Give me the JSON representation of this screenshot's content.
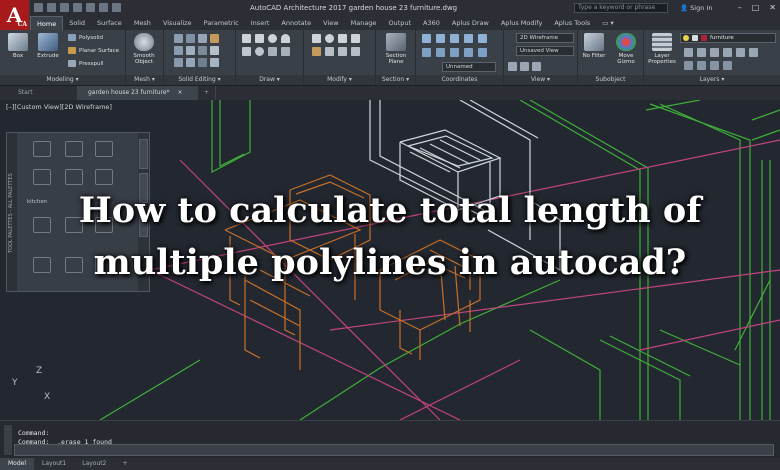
{
  "titlebar": {
    "app_letter": "A",
    "app_suffix": "CA",
    "title": "AutoCAD Architecture 2017   garden house 23 furniture.dwg",
    "search_placeholder": "Type a keyword or phrase",
    "sign_in": "Sign In",
    "minimize": "–",
    "maximize": "□",
    "close": "✕"
  },
  "ribbon_tabs": [
    "Home",
    "Solid",
    "Surface",
    "Mesh",
    "Visualize",
    "Parametric",
    "Insert",
    "Annotate",
    "View",
    "Manage",
    "Output",
    "A360",
    "Aplus Draw",
    "Aplus Modify",
    "Aplus Tools",
    "▭ ▾"
  ],
  "ribbon": {
    "modeling": {
      "label": "Modeling ▾",
      "box": "Box",
      "extrude": "Extrude",
      "polysolid": "Polysolid",
      "planar_surface": "Planar Surface",
      "presspull": "Presspull"
    },
    "mesh": {
      "label": "Mesh ▾",
      "smooth_object": "Smooth Object"
    },
    "solid_editing": {
      "label": "Solid Editing ▾"
    },
    "draw": {
      "label": "Draw ▾"
    },
    "modify": {
      "label": "Modify ▾"
    },
    "section": {
      "label": "Section ▾",
      "section_plane": "Section Plane"
    },
    "coordinates": {
      "label": "Coordinates",
      "unnamed": "Unnamed"
    },
    "view": {
      "label": "View ▾",
      "visual_style": "2D Wireframe",
      "saved_view": "Unsaved View"
    },
    "subobject": {
      "label": "Subobject",
      "no_filter": "No Filter",
      "move_gizmo": "Move Gizmo"
    },
    "layers": {
      "label": "Layers ▾",
      "layer_properties": "Layer Properties",
      "current_layer": "furniture"
    }
  },
  "file_tabs": {
    "start": "Start",
    "drawing": "garden house 23 furniture*",
    "close": "×",
    "new_tab": "+"
  },
  "viewport": {
    "label": "[–][Custom View][2D Wireframe]",
    "palette_title": "TOOL PALETTES - ALL PALETTES",
    "palette_category": "kitchen",
    "ucs_x": "X",
    "ucs_y": "Y",
    "ucs_z": "Z"
  },
  "headline": {
    "line1": "How to calculate total length of",
    "line2": "multiple polylines in autocad?"
  },
  "command": {
    "line1": "Command:",
    "line2": "Command: _.erase 1 found"
  },
  "layout_tabs": [
    "Model",
    "Layout1",
    "Layout2",
    "+"
  ],
  "colors": {
    "wire_orange": "#c7702a",
    "wire_green": "#3fae3a",
    "wire_magenta": "#c0447d",
    "wire_white": "#cfd6dc",
    "app_red": "#a8191c"
  }
}
